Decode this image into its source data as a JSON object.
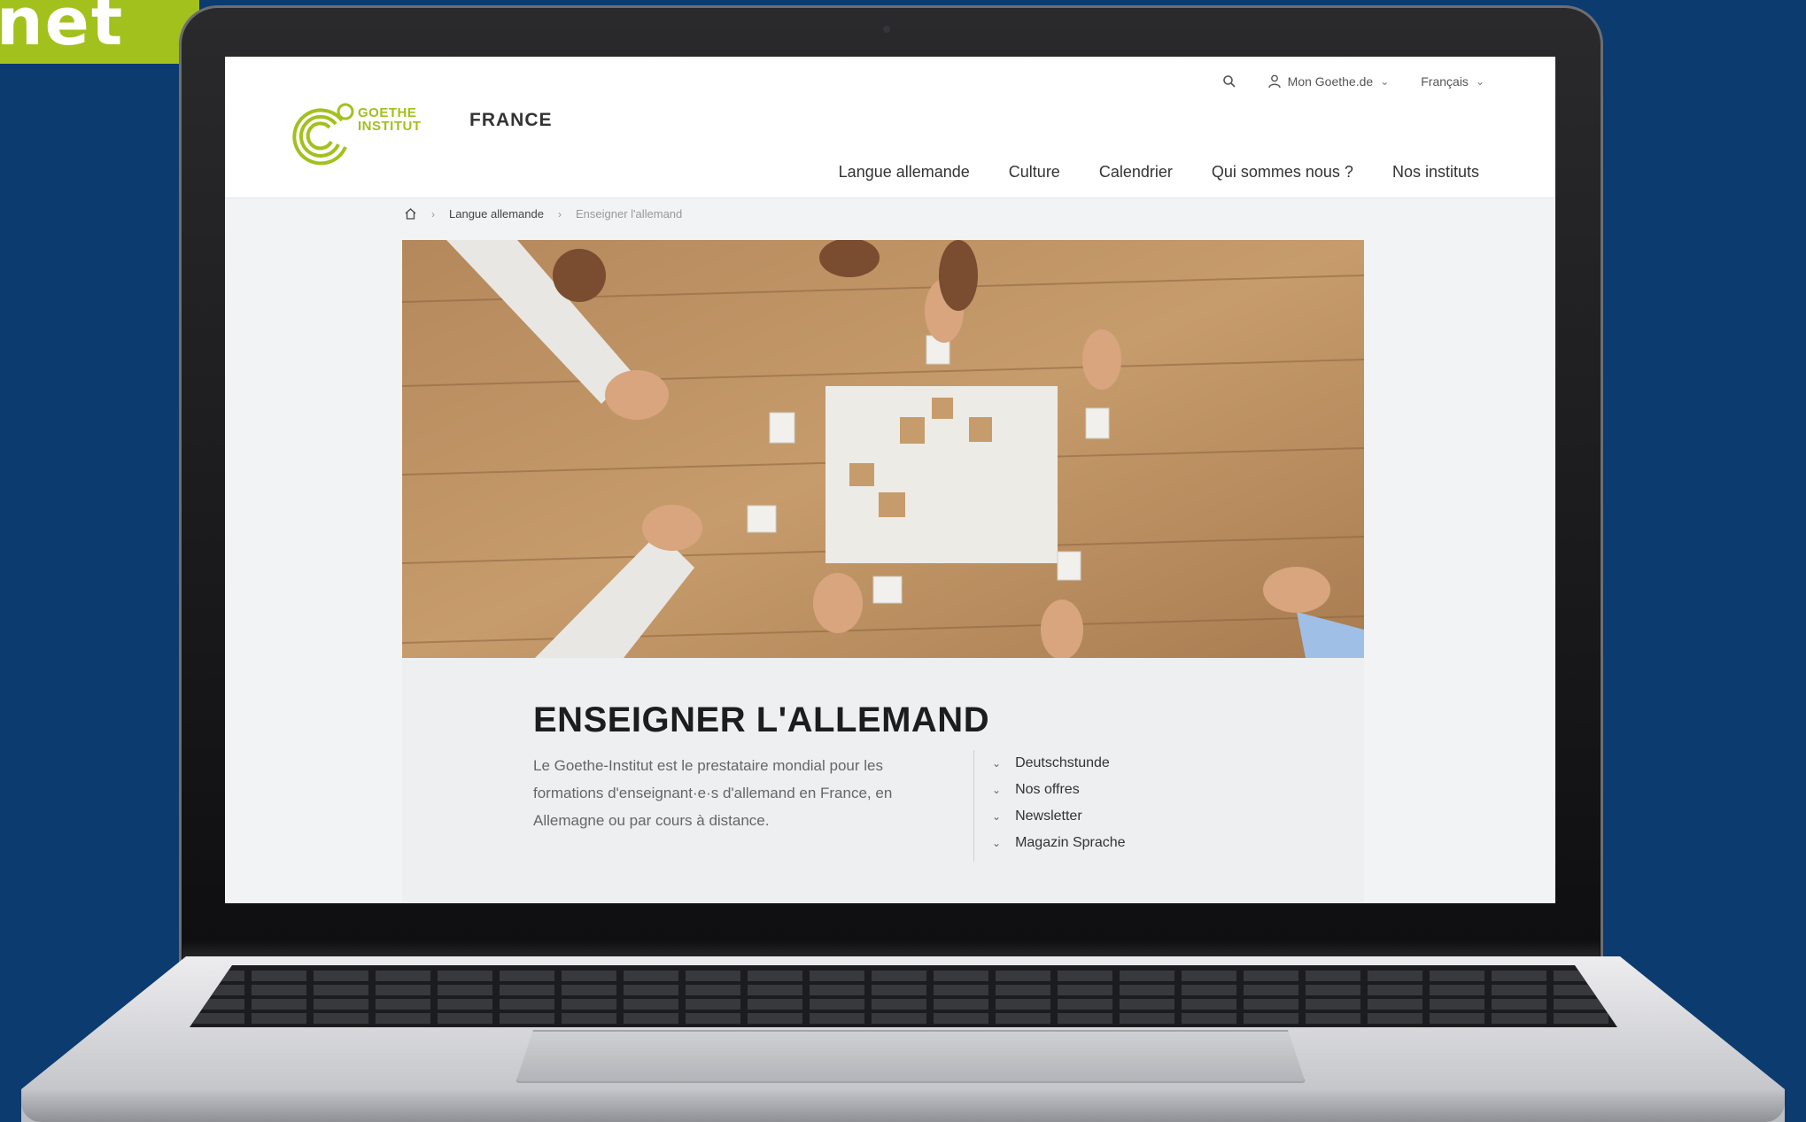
{
  "badge": {
    "text": "net"
  },
  "header": {
    "logo_text_line1": "GOETHE",
    "logo_text_line2": "INSTITUT",
    "country": "FRANCE",
    "account_label": "Mon Goethe.de",
    "language_label": "Français"
  },
  "nav": {
    "items": [
      {
        "label": "Langue allemande"
      },
      {
        "label": "Culture"
      },
      {
        "label": "Calendrier"
      },
      {
        "label": "Qui sommes nous ?"
      },
      {
        "label": "Nos instituts"
      }
    ]
  },
  "breadcrumb": {
    "items": [
      {
        "label": "Langue allemande"
      },
      {
        "label": "Enseigner l'allemand"
      }
    ]
  },
  "main": {
    "title": "ENSEIGNER L'ALLEMAND",
    "intro": "Le Goethe-Institut est le prestataire mondial pour les formations d'enseignant·e·s d'allemand en France, en Allemagne ou par cours à distance.",
    "links": [
      {
        "label": "Deutschstunde"
      },
      {
        "label": "Nos offres"
      },
      {
        "label": "Newsletter"
      },
      {
        "label": "Magazin Sprache"
      }
    ]
  },
  "colors": {
    "brand_green": "#a2c11d",
    "background_blue": "#0b3b6f"
  },
  "icons": [
    "search-icon",
    "user-icon",
    "chevron-down-icon",
    "home-icon"
  ]
}
